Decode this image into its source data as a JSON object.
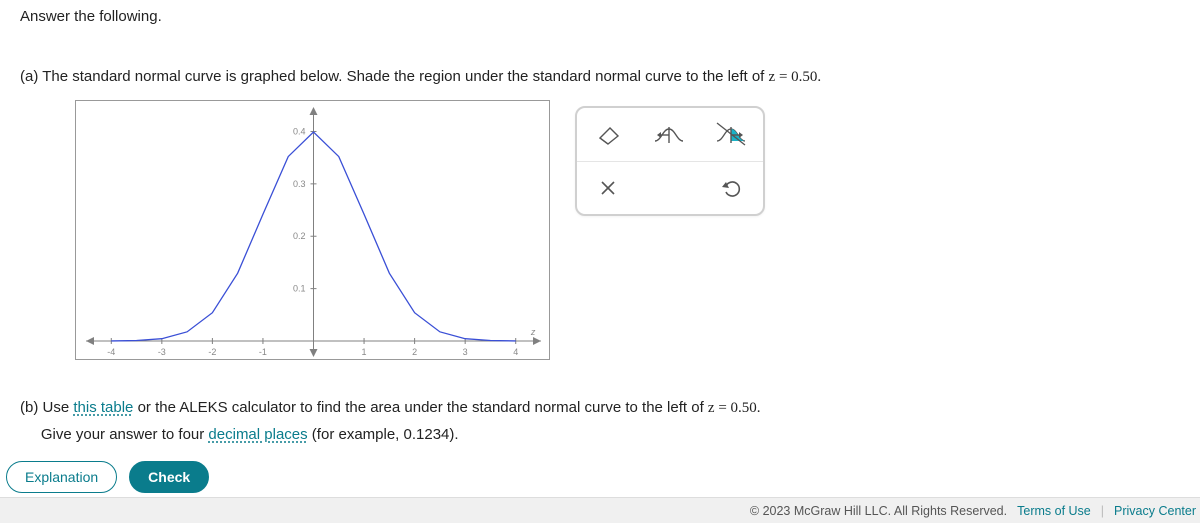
{
  "header": {
    "prompt": "Answer the following."
  },
  "partA": {
    "label": "(a)",
    "text": "The standard normal curve is graphed below. Shade the region under the standard normal curve to the left of ",
    "z_expr": "z = 0.50."
  },
  "chart_data": {
    "type": "line",
    "title": "",
    "xlabel": "",
    "ylabel": "",
    "xlim": [
      -4.5,
      4.5
    ],
    "ylim": [
      0,
      0.42
    ],
    "x_ticks": [
      -4,
      -3,
      -2,
      -1,
      0,
      1,
      2,
      3,
      4
    ],
    "y_ticks": [
      0.1,
      0.2,
      0.3,
      0.4
    ],
    "series": [
      {
        "name": "standard_normal_pdf",
        "x": [
          -4.0,
          -3.5,
          -3.0,
          -2.5,
          -2.0,
          -1.5,
          -1.0,
          -0.5,
          0.0,
          0.5,
          1.0,
          1.5,
          2.0,
          2.5,
          3.0,
          3.5,
          4.0
        ],
        "values": [
          0.0001,
          0.0009,
          0.0044,
          0.0175,
          0.054,
          0.1295,
          0.242,
          0.3521,
          0.3989,
          0.3521,
          0.242,
          0.1295,
          0.054,
          0.0175,
          0.0044,
          0.0009,
          0.0001
        ]
      }
    ]
  },
  "tools": {
    "row1": [
      "eraser-icon",
      "shade-left-icon",
      "shade-right-icon"
    ],
    "row2": [
      "close-icon",
      "undo-icon"
    ]
  },
  "partB": {
    "label": "(b)",
    "pre": "Use ",
    "link1": "this table",
    "mid": " or the ALEKS calculator to find the area under the standard normal curve to the left of ",
    "z_expr": "z = 0.50.",
    "line2_pre": "Give your answer to four ",
    "link2": "decimal places",
    "line2_post": " (for example, 0.1234)."
  },
  "buttons": {
    "explanation": "Explanation",
    "check": "Check"
  },
  "footer": {
    "copyright": "© 2023 McGraw Hill LLC. All Rights Reserved.",
    "terms": "Terms of Use",
    "privacy": "Privacy Center"
  }
}
